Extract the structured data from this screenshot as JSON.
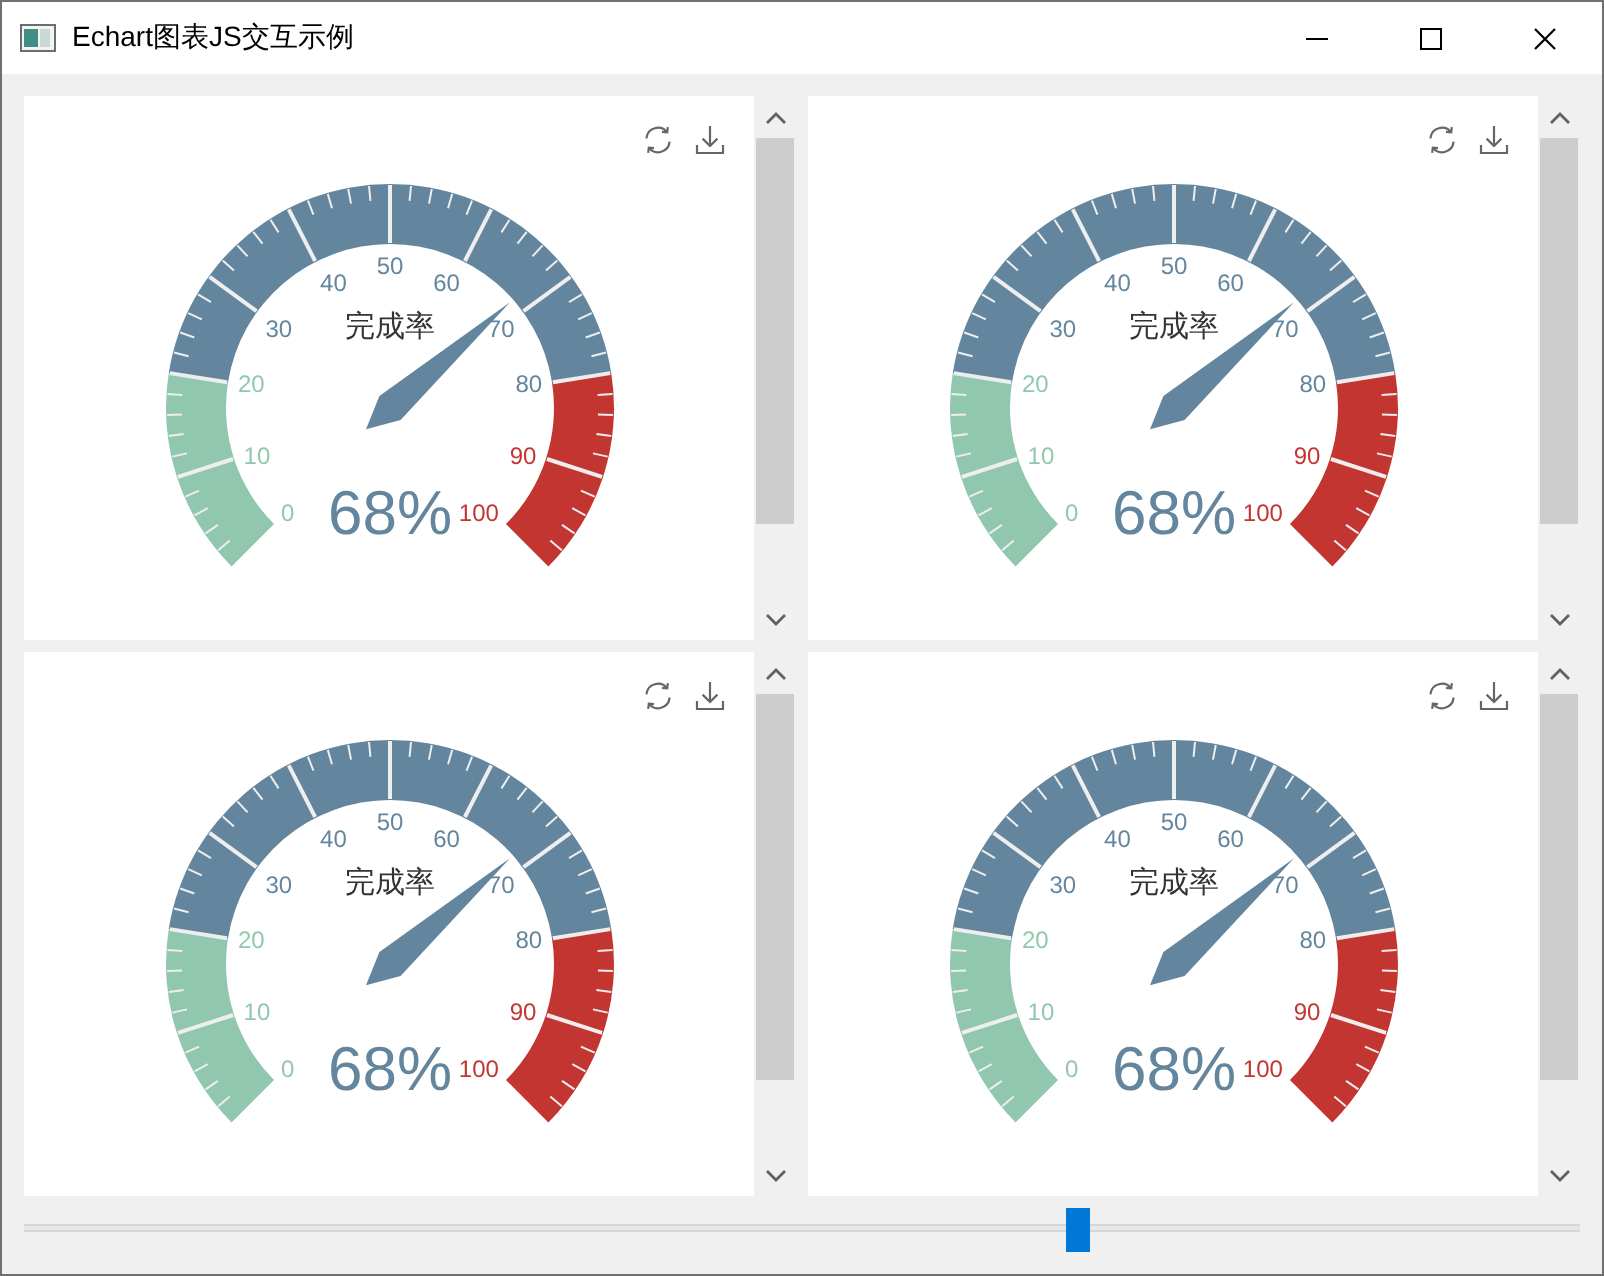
{
  "window": {
    "title": "Echart图表JS交互示例"
  },
  "charts": [
    {
      "title": "完成率",
      "value_text": "68%",
      "level": 0.68,
      "axis_labels": [
        "0",
        "10",
        "20",
        "30",
        "40",
        "50",
        "60",
        "70",
        "80",
        "90",
        "100"
      ]
    },
    {
      "title": "完成率",
      "value_text": "68%",
      "level": 0.68,
      "axis_labels": [
        "0",
        "10",
        "20",
        "30",
        "40",
        "50",
        "60",
        "70",
        "80",
        "90",
        "100"
      ]
    },
    {
      "title": "完成率",
      "value_text": "68%",
      "level": 0.68,
      "axis_labels": [
        "0",
        "10",
        "20",
        "30",
        "40",
        "50",
        "60",
        "70",
        "80",
        "90",
        "100"
      ]
    },
    {
      "title": "完成率",
      "value_text": "68%",
      "level": 0.68,
      "axis_labels": [
        "0",
        "10",
        "20",
        "30",
        "40",
        "50",
        "60",
        "70",
        "80",
        "90",
        "100"
      ]
    }
  ],
  "slider": {
    "level": 0.68
  }
}
